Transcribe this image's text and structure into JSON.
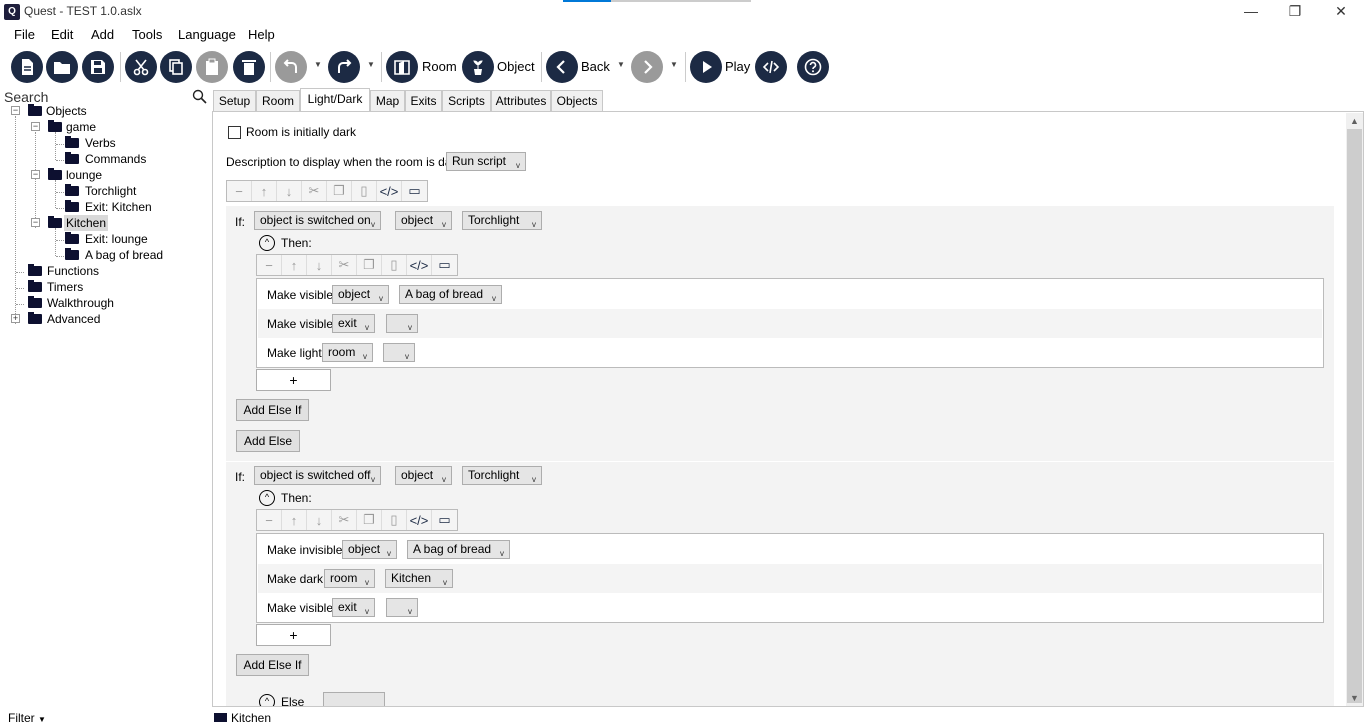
{
  "window": {
    "title": "Quest - TEST 1.0.aslx",
    "minimize": "—",
    "restore": "❐",
    "close": "✕"
  },
  "menu": [
    "File",
    "Edit",
    "Add",
    "Tools",
    "Language",
    "Help"
  ],
  "toolbar": {
    "room_label": "Room",
    "object_label": "Object",
    "back_label": "Back",
    "play_label": "Play"
  },
  "search": {
    "placeholder": "Search"
  },
  "tree": {
    "objects": "Objects",
    "game": "game",
    "verbs": "Verbs",
    "commands": "Commands",
    "lounge": "lounge",
    "torchlight": "Torchlight",
    "exit_kitchen": "Exit: Kitchen",
    "kitchen": "Kitchen",
    "exit_lounge": "Exit: lounge",
    "bag_of_bread": "A bag of bread",
    "functions": "Functions",
    "timers": "Timers",
    "walkthrough": "Walkthrough",
    "advanced": "Advanced"
  },
  "filter": {
    "label": "Filter"
  },
  "tabs": [
    "Setup",
    "Room",
    "Light/Dark",
    "Map",
    "Exits",
    "Scripts",
    "Attributes",
    "Objects"
  ],
  "active_tab": "Light/Dark",
  "panel": {
    "room_dark_label": "Room is initially dark",
    "description_label": "Description to display when the room is dark:",
    "description_value": "Run script",
    "if_label": "If:",
    "then_label": "Then:",
    "add_else_if": "Add Else If",
    "add_else": "Add Else",
    "else_label": "Else",
    "if1": {
      "cond": "object is switched on",
      "type": "object",
      "target": "Torchlight",
      "rows": [
        {
          "action": "Make visible",
          "kind": "object",
          "target": "A bag of bread"
        },
        {
          "action": "Make visible",
          "kind": "exit",
          "target": ""
        },
        {
          "action": "Make light",
          "kind": "room",
          "target": ""
        }
      ]
    },
    "if2": {
      "cond": "object is switched off",
      "type": "object",
      "target": "Torchlight",
      "rows": [
        {
          "action": "Make invisible",
          "kind": "object",
          "target": "A bag of bread"
        },
        {
          "action": "Make dark",
          "kind": "room",
          "target": "Kitchen"
        },
        {
          "action": "Make visible",
          "kind": "exit",
          "target": ""
        }
      ]
    },
    "plus": "+"
  },
  "status": {
    "current": "Kitchen"
  }
}
